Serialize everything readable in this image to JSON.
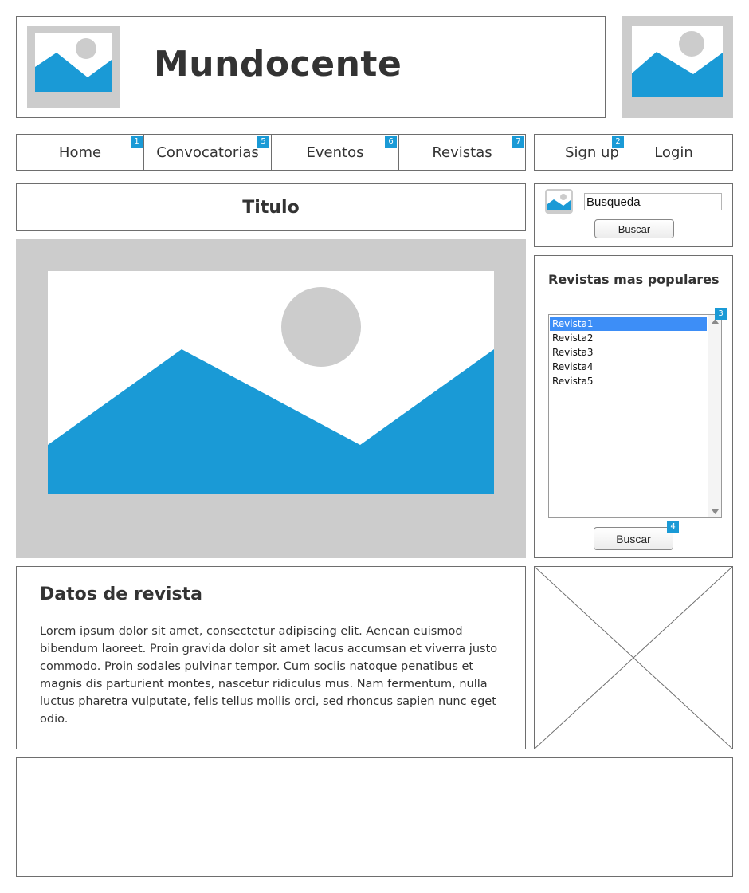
{
  "header": {
    "site_title": "Mundocente"
  },
  "nav": {
    "items": [
      {
        "label": "Home",
        "badge": "1"
      },
      {
        "label": "Convocatorias",
        "badge": "5"
      },
      {
        "label": "Eventos",
        "badge": "6"
      },
      {
        "label": "Revistas",
        "badge": "7"
      }
    ]
  },
  "account": {
    "signup_label": "Sign up",
    "signup_badge": "2",
    "login_label": "Login"
  },
  "main": {
    "title": "Titulo"
  },
  "search": {
    "value": "Busqueda",
    "button_label": "Buscar"
  },
  "popular": {
    "heading": "Revistas mas populares",
    "list_badge": "3",
    "items": [
      "Revista1",
      "Revista2",
      "Revista3",
      "Revista4",
      "Revista5"
    ],
    "selected_index": 0,
    "button_label": "Buscar",
    "button_badge": "4"
  },
  "details": {
    "heading": "Datos de revista",
    "body": "Lorem ipsum dolor sit amet, consectetur adipiscing elit. Aenean euismod bibendum laoreet. Proin gravida dolor sit amet lacus accumsan et viverra justo commodo. Proin sodales pulvinar tempor. Cum sociis natoque penatibus et magnis dis parturient montes, nascetur ridiculus mus. Nam fermentum, nulla luctus pharetra vulputate, felis tellus mollis orci, sed rhoncus sapien nunc eget odio."
  },
  "colors": {
    "accent": "#1a9ad6",
    "placeholder_gray": "#cccccc",
    "selection": "#3d8ef7"
  },
  "icons": [
    "image-placeholder-icon",
    "crossed-placeholder"
  ]
}
